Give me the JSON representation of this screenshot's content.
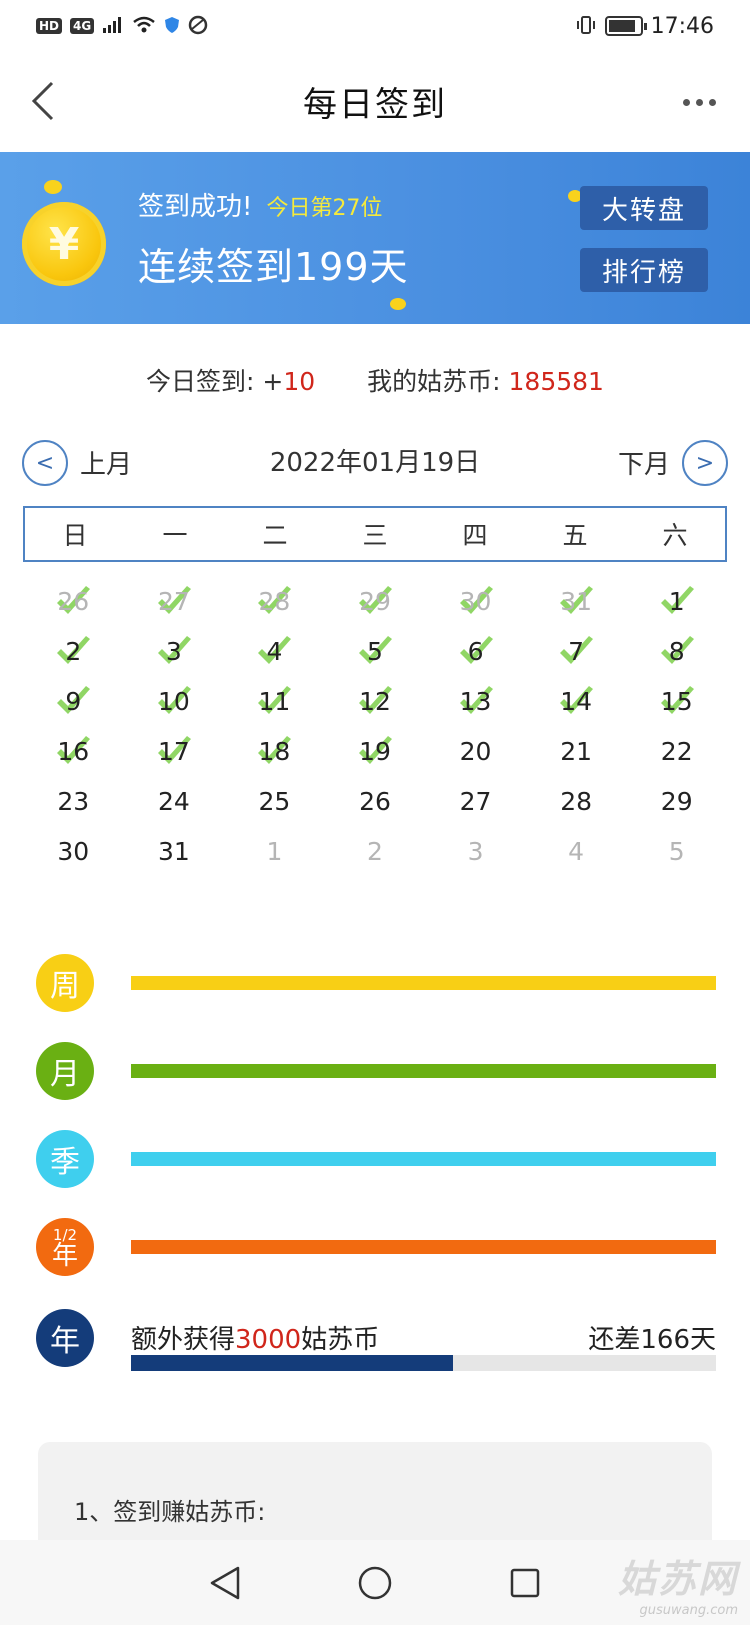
{
  "status_bar": {
    "hd": "HD",
    "network": "4G",
    "time": "17:46",
    "icons": [
      "signal-icon",
      "wifi-icon",
      "shield-icon",
      "browser-icon",
      "vibrate-icon",
      "battery-icon"
    ]
  },
  "header": {
    "title": "每日签到",
    "back_icon": "back-chevron-icon",
    "more_icon": "more-dots-icon"
  },
  "banner": {
    "success": "签到成功!",
    "rank": "今日第27位",
    "streak": "连续签到199天",
    "wheel_button": "大转盘",
    "leaderboard_button": "排行榜",
    "coin_symbol": "¥",
    "background_color": "#4a8fe0",
    "button_color": "#2e5fa9",
    "rank_color": "#f6ea3b"
  },
  "summary": {
    "today_label": "今日签到: +",
    "today_value": "10",
    "coins_label": "我的姑苏币: ",
    "coins_value": "185581",
    "value_color": "#d0261b"
  },
  "month_nav": {
    "prev_symbol": "<",
    "prev_label": "上月",
    "current_date": "2022年01月19日",
    "next_label": "下月",
    "next_symbol": ">"
  },
  "weekdays": [
    "日",
    "一",
    "二",
    "三",
    "四",
    "五",
    "六"
  ],
  "calendar": {
    "days": [
      {
        "label": "26",
        "other": true,
        "checked": true
      },
      {
        "label": "27",
        "other": true,
        "checked": true
      },
      {
        "label": "28",
        "other": true,
        "checked": true
      },
      {
        "label": "29",
        "other": true,
        "checked": true
      },
      {
        "label": "30",
        "other": true,
        "checked": true
      },
      {
        "label": "31",
        "other": true,
        "checked": true
      },
      {
        "label": "1",
        "other": false,
        "checked": true
      },
      {
        "label": "2",
        "other": false,
        "checked": true
      },
      {
        "label": "3",
        "other": false,
        "checked": true
      },
      {
        "label": "4",
        "other": false,
        "checked": true
      },
      {
        "label": "5",
        "other": false,
        "checked": true
      },
      {
        "label": "6",
        "other": false,
        "checked": true
      },
      {
        "label": "7",
        "other": false,
        "checked": true
      },
      {
        "label": "8",
        "other": false,
        "checked": true
      },
      {
        "label": "9",
        "other": false,
        "checked": true
      },
      {
        "label": "10",
        "other": false,
        "checked": true
      },
      {
        "label": "11",
        "other": false,
        "checked": true
      },
      {
        "label": "12",
        "other": false,
        "checked": true
      },
      {
        "label": "13",
        "other": false,
        "checked": true
      },
      {
        "label": "14",
        "other": false,
        "checked": true
      },
      {
        "label": "15",
        "other": false,
        "checked": true
      },
      {
        "label": "16",
        "other": false,
        "checked": true
      },
      {
        "label": "17",
        "other": false,
        "checked": true
      },
      {
        "label": "18",
        "other": false,
        "checked": true
      },
      {
        "label": "19",
        "other": false,
        "checked": true
      },
      {
        "label": "20",
        "other": false,
        "checked": false
      },
      {
        "label": "21",
        "other": false,
        "checked": false
      },
      {
        "label": "22",
        "other": false,
        "checked": false
      },
      {
        "label": "23",
        "other": false,
        "checked": false
      },
      {
        "label": "24",
        "other": false,
        "checked": false
      },
      {
        "label": "25",
        "other": false,
        "checked": false
      },
      {
        "label": "26",
        "other": false,
        "checked": false
      },
      {
        "label": "27",
        "other": false,
        "checked": false
      },
      {
        "label": "28",
        "other": false,
        "checked": false
      },
      {
        "label": "29",
        "other": false,
        "checked": false
      },
      {
        "label": "30",
        "other": false,
        "checked": false
      },
      {
        "label": "31",
        "other": false,
        "checked": false
      },
      {
        "label": "1",
        "other": true,
        "checked": false
      },
      {
        "label": "2",
        "other": true,
        "checked": false
      },
      {
        "label": "3",
        "other": true,
        "checked": false
      },
      {
        "label": "4",
        "other": true,
        "checked": false
      },
      {
        "label": "5",
        "other": true,
        "checked": false
      }
    ],
    "check_color": "#7dcf4a"
  },
  "progress": {
    "week": {
      "badge": "周",
      "color": "#f8cf15",
      "progress": 1.0
    },
    "month": {
      "badge": "月",
      "color": "#6ab013",
      "progress": 1.0
    },
    "quarter": {
      "badge": "季",
      "color": "#3fcfee",
      "progress": 1.0
    },
    "half_year": {
      "badge_top": "1/2",
      "badge_bottom": "年",
      "color": "#f26a10",
      "progress": 1.0
    },
    "year": {
      "badge": "年",
      "color": "#143c7a",
      "text_prefix": "额外获得",
      "text_amount": "3000",
      "text_suffix": "姑苏币",
      "remaining": "还差166天",
      "progress": 0.55
    }
  },
  "rules": {
    "line1": "1、签到赚姑苏币:"
  },
  "bottom_nav": {
    "icons": [
      "nav-back-icon",
      "nav-home-icon",
      "nav-recent-icon"
    ]
  },
  "watermark": {
    "main": "姑苏网",
    "sub": "gusuwang.com"
  }
}
